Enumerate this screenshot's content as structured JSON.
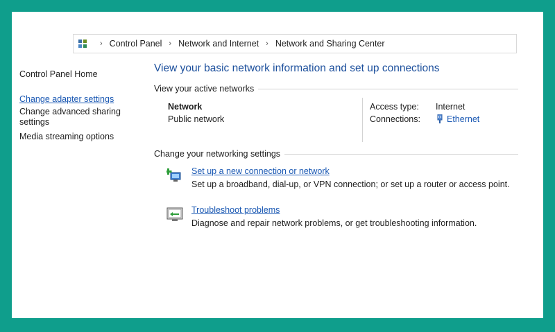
{
  "breadcrumb": {
    "icon": "control-panel-icon",
    "items": [
      "Control Panel",
      "Network and Internet",
      "Network and Sharing Center"
    ]
  },
  "nav": {
    "home": "Control Panel Home",
    "adapter": "Change adapter settings",
    "advanced_sharing": "Change advanced sharing settings",
    "media_streaming": "Media streaming options"
  },
  "main": {
    "title": "View your basic network information and set up connections",
    "active_networks_heading": "View your active networks",
    "network": {
      "name": "Network",
      "type": "Public network",
      "access_type_label": "Access type:",
      "access_type_value": "Internet",
      "connections_label": "Connections:",
      "connections_value": "Ethernet",
      "connections_icon": "ethernet-icon"
    },
    "settings_heading": "Change your networking settings",
    "tasks": [
      {
        "icon": "new-connection-icon",
        "link": "Set up a new connection or network",
        "desc": "Set up a broadband, dial-up, or VPN connection; or set up a router or access point."
      },
      {
        "icon": "troubleshoot-icon",
        "link": "Troubleshoot problems",
        "desc": "Diagnose and repair network problems, or get troubleshooting information."
      }
    ]
  },
  "colors": {
    "frame": "#0f9e8c",
    "link": "#1a58b3",
    "title": "#1c4f9c"
  }
}
